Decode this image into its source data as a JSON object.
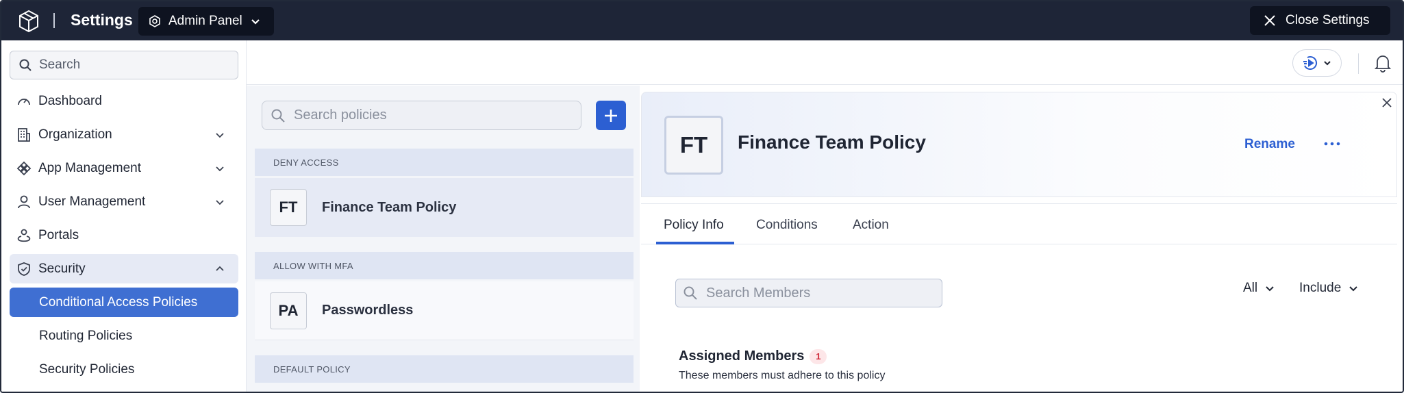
{
  "topbar": {
    "title": "Settings",
    "admin_panel_label": "Admin Panel",
    "close_label": "Close Settings"
  },
  "sidebar": {
    "search_placeholder": "Search",
    "items": [
      {
        "label": "Dashboard",
        "icon": "dashboard-icon"
      },
      {
        "label": "Organization",
        "icon": "organization-icon",
        "expandable": true
      },
      {
        "label": "App Management",
        "icon": "app-management-icon",
        "expandable": true
      },
      {
        "label": "User Management",
        "icon": "user-icon",
        "expandable": true
      },
      {
        "label": "Portals",
        "icon": "portals-icon"
      },
      {
        "label": "Security",
        "icon": "shield-icon",
        "expandable": true,
        "expanded": true
      }
    ],
    "security_children": [
      {
        "label": "Conditional Access Policies",
        "active": true
      },
      {
        "label": "Routing Policies"
      },
      {
        "label": "Security Policies"
      }
    ]
  },
  "policies": {
    "search_placeholder": "Search policies",
    "groups": [
      {
        "header": "DENY ACCESS",
        "items": [
          {
            "initials": "FT",
            "name": "Finance Team Policy",
            "selected": true
          }
        ]
      },
      {
        "header": "ALLOW WITH MFA",
        "items": [
          {
            "initials": "PA",
            "name": "Passwordless"
          }
        ]
      },
      {
        "header": "DEFAULT POLICY",
        "items": []
      }
    ]
  },
  "detail": {
    "initials": "FT",
    "title": "Finance Team Policy",
    "rename_label": "Rename",
    "tabs": [
      "Policy Info",
      "Conditions",
      "Action"
    ],
    "active_tab": "Policy Info",
    "member_search_placeholder": "Search Members",
    "filter_scope": "All",
    "filter_mode": "Include",
    "assigned_title": "Assigned Members",
    "assigned_count": "1",
    "assigned_subtitle": "These members must adhere to this policy"
  },
  "colors": {
    "topbar": "#1e2537",
    "accent": "#2c5fd2",
    "active_nav": "#3f6fd2",
    "badge_bg": "#fde6e8",
    "badge_text": "#d02a3b"
  }
}
